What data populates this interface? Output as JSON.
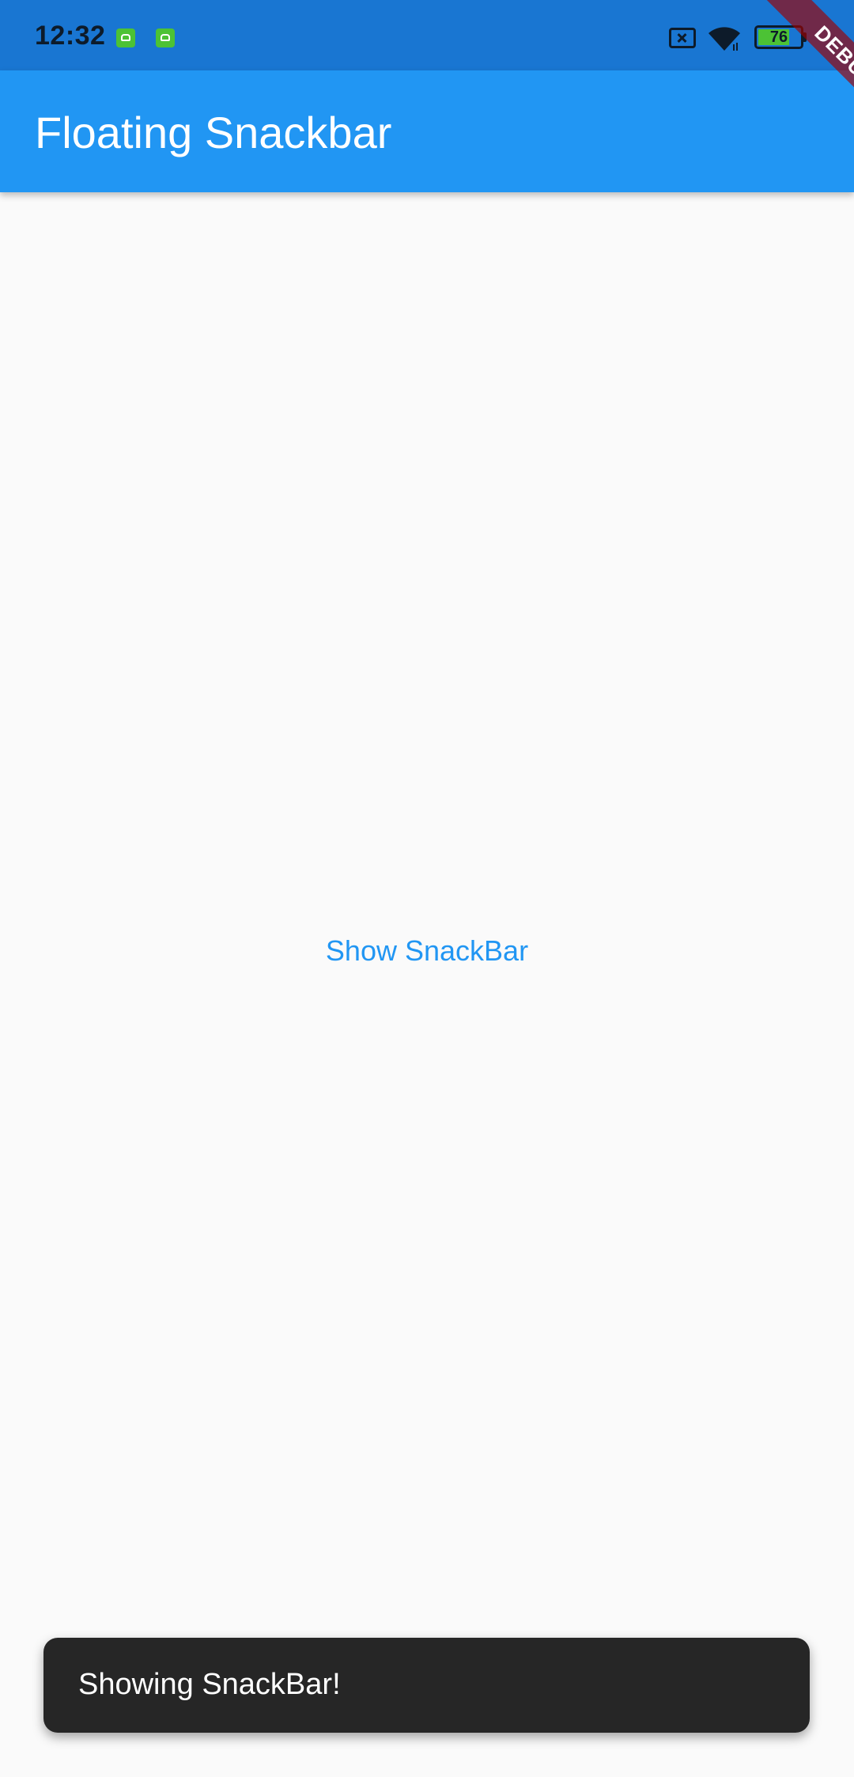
{
  "status_bar": {
    "time": "12:32",
    "battery_level": "76",
    "battery_fraction": 0.76,
    "icons": [
      "android-notification-icon",
      "android-notification-icon",
      "no-sim-icon",
      "wifi-icon",
      "battery-icon"
    ]
  },
  "app_bar": {
    "title": "Floating Snackbar",
    "color": "#2196f3"
  },
  "debug_banner": {
    "label": "DEBUG"
  },
  "main": {
    "button_label": "Show SnackBar",
    "button_color": "#2196f3"
  },
  "snackbar": {
    "message": "Showing SnackBar!",
    "background": "#262626"
  },
  "colors": {
    "status_bar": "#1976d2",
    "background": "#fafafa",
    "notification_icon": "#4cc235"
  }
}
